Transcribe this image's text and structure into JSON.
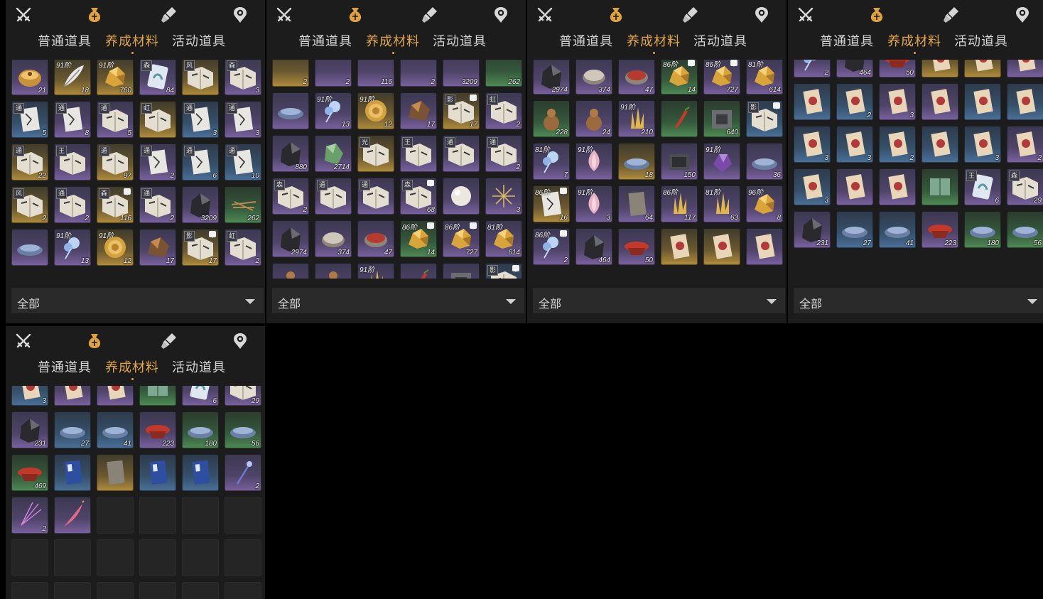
{
  "tabs": [
    "普通道具",
    "养成材料",
    "活动道具"
  ],
  "active_tab": 1,
  "filter_label": "全部",
  "top_icons": [
    "crossed-swords-icon",
    "money-bag-icon",
    "scroll-brush-icon",
    "settings-icon"
  ],
  "panels": [
    {
      "name": "panel-1",
      "rows": [
        [
          {
            "r": "purple",
            "ic": "bowl",
            "n": "21"
          },
          {
            "r": "gold",
            "ic": "feather",
            "n": "18",
            "t": "91阶"
          },
          {
            "r": "gold",
            "ic": "ore-gold",
            "n": "760",
            "t": "91阶"
          },
          {
            "r": "purple",
            "ic": "card-blue",
            "n": "84",
            "tag": "森"
          },
          {
            "r": "gold",
            "ic": "book",
            "n": "",
            "tag": "风"
          },
          {
            "r": "purple",
            "ic": "book",
            "n": "3",
            "tag": "森"
          }
        ],
        [
          {
            "r": "blue",
            "ic": "scroll",
            "n": "5",
            "tag": "通"
          },
          {
            "r": "purple",
            "ic": "scroll",
            "n": "8",
            "tag": "通"
          },
          {
            "r": "purple",
            "ic": "book",
            "n": "5",
            "tag": "通"
          },
          {
            "r": "gold",
            "ic": "book",
            "n": "",
            "tag": "虹"
          },
          {
            "r": "blue",
            "ic": "scroll",
            "n": "3",
            "tag": "通"
          },
          {
            "r": "purple",
            "ic": "scroll",
            "n": "3",
            "tag": "通"
          }
        ],
        [
          {
            "r": "gold",
            "ic": "book",
            "n": "22",
            "tag": "通"
          },
          {
            "r": "purple",
            "ic": "book",
            "n": "",
            "tag": "王"
          },
          {
            "r": "gold",
            "ic": "book",
            "n": "97",
            "tag": "通"
          },
          {
            "r": "purple",
            "ic": "scroll",
            "n": "2",
            "tag": "通"
          },
          {
            "r": "blue",
            "ic": "scroll",
            "n": "6",
            "tag": "通"
          },
          {
            "r": "blue",
            "ic": "scroll",
            "n": "10",
            "tag": "通"
          }
        ],
        [
          {
            "r": "gold",
            "ic": "book",
            "n": "2",
            "tag": "风"
          },
          {
            "r": "purple",
            "ic": "book",
            "n": "2",
            "tag": "通"
          },
          {
            "r": "gold",
            "ic": "book",
            "n": "116",
            "tag": "森",
            "mark": true
          },
          {
            "r": "purple",
            "ic": "book",
            "n": "2",
            "tag": "通"
          },
          {
            "r": "purple",
            "ic": "rock",
            "n": "3209"
          },
          {
            "r": "green",
            "ic": "twigs",
            "n": "262"
          }
        ],
        [
          {
            "r": "purple",
            "ic": "dish",
            "n": ""
          },
          {
            "r": "purple",
            "ic": "flower-blue",
            "n": "13",
            "t": "91阶"
          },
          {
            "r": "gold",
            "ic": "shell",
            "n": "12",
            "t": "91阶"
          },
          {
            "r": "purple",
            "ic": "ore-brown",
            "n": "17"
          },
          {
            "r": "gold",
            "ic": "book",
            "n": "17",
            "tag": "影",
            "mark": true
          },
          {
            "r": "purple",
            "ic": "book",
            "n": "2",
            "tag": "虹"
          }
        ]
      ]
    },
    {
      "name": "panel-2",
      "rows": [
        [
          {
            "r": "gold",
            "ic": "none",
            "n": "2"
          },
          {
            "r": "purple",
            "ic": "none",
            "n": "2"
          },
          {
            "r": "purple",
            "ic": "none",
            "n": "116"
          },
          {
            "r": "purple",
            "ic": "none",
            "n": "2"
          },
          {
            "r": "purple",
            "ic": "none",
            "n": "3209"
          },
          {
            "r": "green",
            "ic": "none",
            "n": "262"
          }
        ],
        [
          {
            "r": "purple",
            "ic": "dish",
            "n": ""
          },
          {
            "r": "purple",
            "ic": "flower-blue",
            "n": "13",
            "t": "91阶"
          },
          {
            "r": "gold",
            "ic": "shell",
            "n": "12",
            "t": "91阶"
          },
          {
            "r": "purple",
            "ic": "ore-brown",
            "n": "17"
          },
          {
            "r": "gold",
            "ic": "book",
            "n": "17",
            "tag": "影",
            "mark": true
          },
          {
            "r": "purple",
            "ic": "book",
            "n": "2",
            "tag": "虹"
          }
        ],
        [
          {
            "r": "purple",
            "ic": "rock",
            "n": "880"
          },
          {
            "r": "purple",
            "ic": "jade",
            "n": "2714"
          },
          {
            "r": "gold",
            "ic": "book",
            "n": "",
            "tag": "光"
          },
          {
            "r": "purple",
            "ic": "book",
            "n": "",
            "tag": "王"
          },
          {
            "r": "purple",
            "ic": "book",
            "n": "",
            "tag": "通"
          },
          {
            "r": "purple",
            "ic": "book",
            "n": "2",
            "tag": "通"
          }
        ],
        [
          {
            "r": "purple",
            "ic": "book",
            "n": "2",
            "tag": "森"
          },
          {
            "r": "purple",
            "ic": "book",
            "n": "",
            "tag": "通"
          },
          {
            "r": "purple",
            "ic": "book",
            "n": "",
            "tag": "通"
          },
          {
            "r": "purple",
            "ic": "book",
            "n": "68",
            "tag": "森",
            "mark": true
          },
          {
            "r": "purple",
            "ic": "pearl",
            "n": ""
          },
          {
            "r": "purple",
            "ic": "sparkle",
            "n": "3"
          }
        ],
        [
          {
            "r": "purple",
            "ic": "rock",
            "n": "2974"
          },
          {
            "r": "purple",
            "ic": "coin",
            "n": "374"
          },
          {
            "r": "purple",
            "ic": "coin-red",
            "n": "47"
          },
          {
            "r": "green",
            "ic": "ore-gold",
            "n": "14",
            "t": "86阶",
            "mark": true
          },
          {
            "r": "purple",
            "ic": "ore-gold",
            "n": "727",
            "t": "86阶",
            "mark": true
          },
          {
            "r": "purple",
            "ic": "ore-gold",
            "n": "614",
            "t": "81阶"
          }
        ],
        [
          {
            "r": "purple",
            "ic": "gourd",
            "n": "228"
          },
          {
            "r": "purple",
            "ic": "gourd",
            "n": "24"
          },
          {
            "r": "purple",
            "ic": "crystal",
            "n": "210",
            "t": "91阶"
          },
          {
            "r": "purple",
            "ic": "pepper",
            "n": ""
          },
          {
            "r": "purple",
            "ic": "stone-block",
            "n": "640"
          },
          {
            "r": "blue",
            "ic": "book",
            "n": "",
            "tag": "影",
            "mark": true
          }
        ]
      ]
    },
    {
      "name": "panel-3",
      "rows": [
        [
          {
            "r": "purple",
            "ic": "rock",
            "n": "2974"
          },
          {
            "r": "purple",
            "ic": "coin",
            "n": "374"
          },
          {
            "r": "purple",
            "ic": "coin-red",
            "n": "47"
          },
          {
            "r": "green",
            "ic": "ore-gold",
            "n": "14",
            "t": "86阶",
            "mark": true
          },
          {
            "r": "purple",
            "ic": "ore-gold",
            "n": "727",
            "t": "86阶",
            "mark": true
          },
          {
            "r": "purple",
            "ic": "ore-gold",
            "n": "614",
            "t": "81阶"
          }
        ],
        [
          {
            "r": "green",
            "ic": "gourd",
            "n": "228"
          },
          {
            "r": "purple",
            "ic": "gourd",
            "n": "24"
          },
          {
            "r": "purple",
            "ic": "crystal",
            "n": "210",
            "t": "91阶"
          },
          {
            "r": "green",
            "ic": "pepper",
            "n": ""
          },
          {
            "r": "green",
            "ic": "stone-block",
            "n": "640"
          },
          {
            "r": "blue",
            "ic": "book",
            "n": "",
            "tag": "影",
            "mark": true
          }
        ],
        [
          {
            "r": "purple",
            "ic": "flower-blue",
            "n": "7",
            "t": "81阶"
          },
          {
            "r": "purple",
            "ic": "lotus",
            "n": "",
            "t": "91阶"
          },
          {
            "r": "gold",
            "ic": "dish",
            "n": "18"
          },
          {
            "r": "purple",
            "ic": "box",
            "n": "150"
          },
          {
            "r": "purple",
            "ic": "gem-purple",
            "n": "",
            "t": "91阶"
          },
          {
            "r": "purple",
            "ic": "dish",
            "n": "36"
          }
        ],
        [
          {
            "r": "gold",
            "ic": "scroll",
            "n": "16",
            "t": "86阶",
            "mark": true
          },
          {
            "r": "purple",
            "ic": "lotus",
            "n": "3",
            "t": "91阶"
          },
          {
            "r": "purple",
            "ic": "booklet",
            "n": "64"
          },
          {
            "r": "purple",
            "ic": "crystal",
            "n": "117",
            "t": "86阶"
          },
          {
            "r": "purple",
            "ic": "crystal",
            "n": "63",
            "t": "81阶"
          },
          {
            "r": "purple",
            "ic": "ore-gold",
            "n": "8",
            "t": "96阶"
          }
        ],
        [
          {
            "r": "purple",
            "ic": "flower-blue",
            "n": "2",
            "t": "86阶",
            "mark": true
          },
          {
            "r": "purple",
            "ic": "rock",
            "n": "464"
          },
          {
            "r": "purple",
            "ic": "bowl-red",
            "n": "50"
          },
          {
            "r": "gold",
            "ic": "scroll-red",
            "n": ""
          },
          {
            "r": "gold",
            "ic": "scroll-red",
            "n": ""
          },
          {
            "r": "purple",
            "ic": "scroll-red",
            "n": ""
          }
        ]
      ]
    },
    {
      "name": "panel-4",
      "rows": [
        [
          {
            "r": "purple",
            "ic": "flower-blue",
            "n": "2",
            "t": "86阶",
            "mark": true
          },
          {
            "r": "purple",
            "ic": "rock",
            "n": "464"
          },
          {
            "r": "purple",
            "ic": "bowl-red",
            "n": "50"
          },
          {
            "r": "gold",
            "ic": "scroll-red",
            "n": ""
          },
          {
            "r": "gold",
            "ic": "scroll-red",
            "n": ""
          },
          {
            "r": "purple",
            "ic": "scroll-red",
            "n": ""
          }
        ],
        [
          {
            "r": "blue",
            "ic": "scroll-red",
            "n": ""
          },
          {
            "r": "blue",
            "ic": "scroll-red",
            "n": "2"
          },
          {
            "r": "purple",
            "ic": "scroll-red",
            "n": "3"
          },
          {
            "r": "purple",
            "ic": "scroll-red",
            "n": ""
          },
          {
            "r": "blue",
            "ic": "scroll-red",
            "n": ""
          },
          {
            "r": "blue",
            "ic": "scroll-red",
            "n": ""
          }
        ],
        [
          {
            "r": "blue",
            "ic": "scroll-red",
            "n": "3"
          },
          {
            "r": "blue",
            "ic": "scroll-red",
            "n": "3"
          },
          {
            "r": "blue",
            "ic": "scroll-red",
            "n": "2"
          },
          {
            "r": "blue",
            "ic": "scroll-red",
            "n": ""
          },
          {
            "r": "blue",
            "ic": "scroll-red",
            "n": "3"
          },
          {
            "r": "purple",
            "ic": "scroll-red",
            "n": "2"
          }
        ],
        [
          {
            "r": "blue",
            "ic": "scroll-red",
            "n": "3"
          },
          {
            "r": "purple",
            "ic": "scroll-red",
            "n": ""
          },
          {
            "r": "purple",
            "ic": "scroll-red",
            "n": ""
          },
          {
            "r": "green",
            "ic": "booklet-green",
            "n": ""
          },
          {
            "r": "purple",
            "ic": "card-blue",
            "n": "6",
            "tag": "王"
          },
          {
            "r": "purple",
            "ic": "book",
            "n": "29",
            "tag": "森"
          }
        ],
        [
          {
            "r": "purple",
            "ic": "rock",
            "n": "231"
          },
          {
            "r": "blue",
            "ic": "dish",
            "n": "27"
          },
          {
            "r": "blue",
            "ic": "dish",
            "n": "41"
          },
          {
            "r": "purple",
            "ic": "bowl-red",
            "n": "223"
          },
          {
            "r": "green",
            "ic": "dish",
            "n": "180"
          },
          {
            "r": "green",
            "ic": "dish",
            "n": "56"
          }
        ]
      ]
    },
    {
      "name": "panel-5",
      "rows": [
        [
          {
            "r": "blue",
            "ic": "scroll-red",
            "n": "3"
          },
          {
            "r": "purple",
            "ic": "scroll-red",
            "n": ""
          },
          {
            "r": "purple",
            "ic": "scroll-red",
            "n": ""
          },
          {
            "r": "green",
            "ic": "booklet-green",
            "n": ""
          },
          {
            "r": "purple",
            "ic": "card-blue",
            "n": "6"
          },
          {
            "r": "purple",
            "ic": "book",
            "n": "29"
          }
        ],
        [
          {
            "r": "purple",
            "ic": "rock",
            "n": "231"
          },
          {
            "r": "blue",
            "ic": "dish",
            "n": "27"
          },
          {
            "r": "blue",
            "ic": "dish",
            "n": "41"
          },
          {
            "r": "purple",
            "ic": "bowl-red",
            "n": "223"
          },
          {
            "r": "green",
            "ic": "dish",
            "n": "180"
          },
          {
            "r": "green",
            "ic": "dish",
            "n": "56"
          }
        ],
        [
          {
            "r": "green",
            "ic": "bowl-red",
            "n": "469"
          },
          {
            "r": "blue",
            "ic": "booklet-blue",
            "n": ""
          },
          {
            "r": "gold",
            "ic": "booklet",
            "n": ""
          },
          {
            "r": "blue",
            "ic": "booklet-blue",
            "n": ""
          },
          {
            "r": "blue",
            "ic": "booklet-blue",
            "n": ""
          },
          {
            "r": "purple",
            "ic": "wand",
            "n": "2"
          }
        ],
        [
          {
            "r": "purple",
            "ic": "firework",
            "n": "2"
          },
          {
            "r": "purple",
            "ic": "quill",
            "n": ""
          },
          {
            "r": "empty",
            "ic": "none",
            "n": ""
          },
          {
            "r": "empty",
            "ic": "none",
            "n": ""
          },
          {
            "r": "empty",
            "ic": "none",
            "n": ""
          },
          {
            "r": "empty",
            "ic": "none",
            "n": ""
          }
        ],
        [
          {
            "r": "empty",
            "ic": "none",
            "n": ""
          },
          {
            "r": "empty",
            "ic": "none",
            "n": ""
          },
          {
            "r": "empty",
            "ic": "none",
            "n": ""
          },
          {
            "r": "empty",
            "ic": "none",
            "n": ""
          },
          {
            "r": "empty",
            "ic": "none",
            "n": ""
          },
          {
            "r": "empty",
            "ic": "none",
            "n": ""
          }
        ],
        [
          {
            "r": "empty",
            "ic": "none",
            "n": ""
          },
          {
            "r": "empty",
            "ic": "none",
            "n": ""
          },
          {
            "r": "empty",
            "ic": "none",
            "n": ""
          },
          {
            "r": "empty",
            "ic": "none",
            "n": ""
          },
          {
            "r": "empty",
            "ic": "none",
            "n": ""
          },
          {
            "r": "empty",
            "ic": "none",
            "n": ""
          }
        ]
      ]
    }
  ]
}
